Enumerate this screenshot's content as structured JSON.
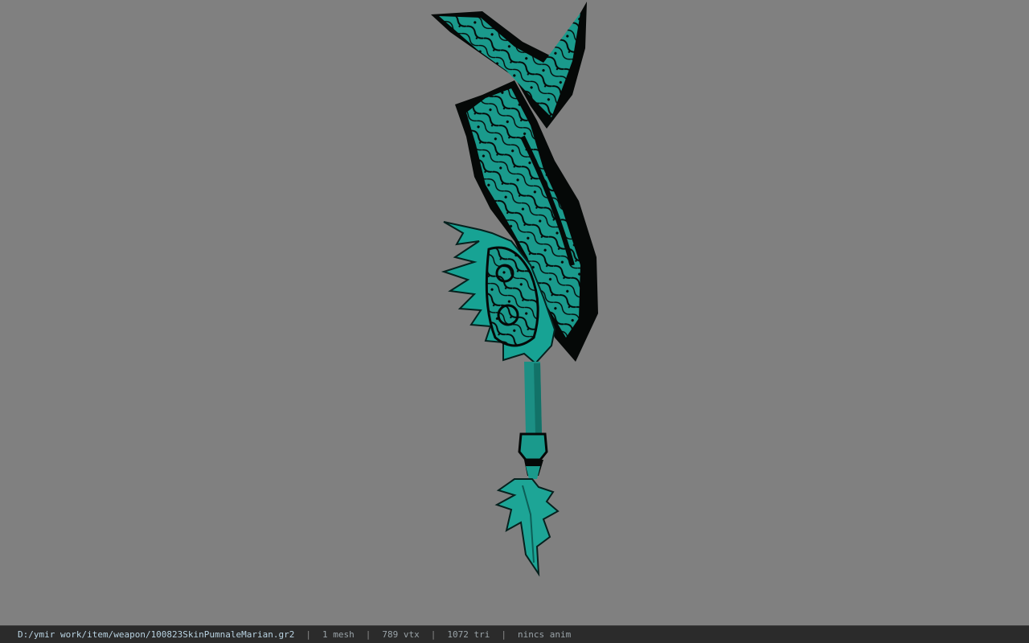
{
  "viewport": {
    "background": "#808080",
    "model_colors": {
      "teal": "#1a9a8c",
      "teal_light": "#29b3a3",
      "dark": "#050807"
    }
  },
  "statusbar": {
    "path": "D:/ymir work/item/weapon/100823SkinPumnaleMarian.gr2",
    "sep": "|",
    "meshes": "1 mesh",
    "vertices": "789 vtx",
    "triangles": "1072 tri",
    "animation": "nincs anim"
  }
}
